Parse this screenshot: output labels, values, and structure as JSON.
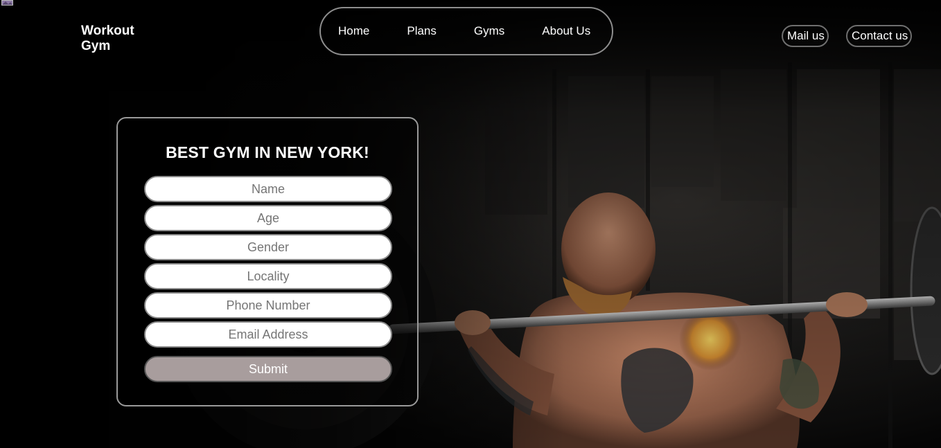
{
  "header": {
    "brand": "Workout Gym",
    "nav": [
      {
        "label": "Home"
      },
      {
        "label": "Plans"
      },
      {
        "label": "Gyms"
      },
      {
        "label": "About Us"
      }
    ],
    "mail_label": "Mail us",
    "contact_label": "Contact us"
  },
  "form": {
    "title": "BEST GYM IN NEW YORK!",
    "fields": [
      {
        "placeholder": "Name",
        "value": ""
      },
      {
        "placeholder": "Age",
        "value": ""
      },
      {
        "placeholder": "Gender",
        "value": ""
      },
      {
        "placeholder": "Locality",
        "value": ""
      },
      {
        "placeholder": "Phone Number",
        "value": ""
      },
      {
        "placeholder": "Email Address",
        "value": ""
      }
    ],
    "submit_label": "Submit"
  },
  "colors": {
    "background": "#050505",
    "text": "#ffffff",
    "nav_border": "#8e8e8e",
    "form_border": "#9a9a9a",
    "submit_bg": "#a89d9d",
    "field_text": "#757575"
  },
  "hero": {
    "image": "man-lifting-barbell-photo"
  }
}
